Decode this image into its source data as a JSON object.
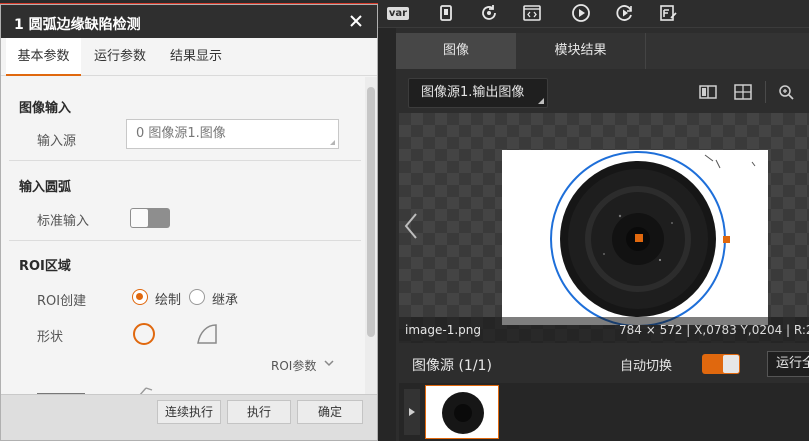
{
  "dialog": {
    "title": "1 圆弧边缘缺陷检测",
    "tabs": [
      {
        "label": "基本参数",
        "active": true
      },
      {
        "label": "运行参数",
        "active": false
      },
      {
        "label": "结果显示",
        "active": false
      }
    ],
    "sections": {
      "image_input": {
        "title": "图像输入",
        "source_label": "输入源",
        "source_value": "0 图像源1.图像"
      },
      "arc_input": {
        "title": "输入圆弧",
        "std_input_label": "标准输入",
        "std_input_enabled": false
      },
      "roi": {
        "title": "ROI区域",
        "create_label": "ROI创建",
        "options": [
          {
            "label": "绘制",
            "selected": true
          },
          {
            "label": "继承",
            "selected": false
          }
        ],
        "shape_label": "形状",
        "params_label": "ROI参数"
      }
    },
    "buttons": {
      "continuous": "连续执行",
      "execute": "执行",
      "confirm": "确定"
    }
  },
  "toolbar": {
    "icons": [
      "var-icon",
      "device-icon",
      "refresh-icon",
      "code-icon",
      "play-icon",
      "loop-run-icon",
      "function-edit-icon"
    ],
    "var_label": "var"
  },
  "viewer": {
    "tabs": [
      {
        "label": "图像",
        "active": true
      },
      {
        "label": "模块结果",
        "active": false
      }
    ],
    "image_select": "图像源1.输出图像",
    "filename": "image-1.png",
    "coords": "784 × 572 | X,0783 Y,0204 | R:2"
  },
  "bottom": {
    "source_label": "图像源 (1/1)",
    "auto_switch_label": "自动切换",
    "auto_switch_on": true,
    "run_label": "运行全"
  },
  "colors": {
    "accent": "#e0680e",
    "title_bar": "#2f2f2f",
    "circle": "#1e6fd9"
  }
}
